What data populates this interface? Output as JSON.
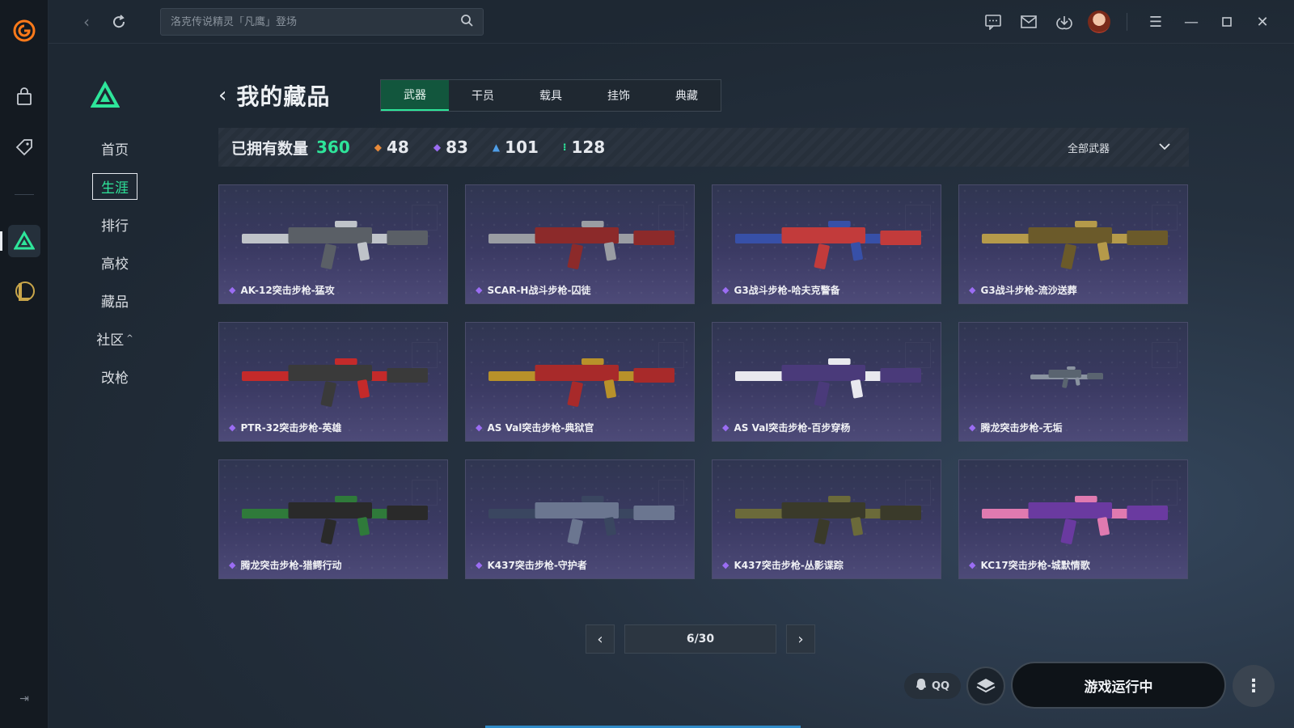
{
  "app": {
    "search_placeholder": "洛克传说精灵「凡鹰」登场"
  },
  "rail": {
    "items": [
      "app-logo",
      "store",
      "discount-tag",
      "delta-force",
      "league-of-legends"
    ]
  },
  "side_menu": {
    "items": [
      {
        "label": "首页",
        "active": false
      },
      {
        "label": "生涯",
        "active": true
      },
      {
        "label": "排行",
        "active": false
      },
      {
        "label": "高校",
        "active": false
      },
      {
        "label": "藏品",
        "active": false
      },
      {
        "label": "社区",
        "active": false,
        "chevron": "^"
      },
      {
        "label": "改枪",
        "active": false
      }
    ]
  },
  "header": {
    "title": "我的藏品",
    "tabs": [
      "武器",
      "干员",
      "载具",
      "挂饰",
      "典藏"
    ],
    "active_tab": "武器"
  },
  "stats": {
    "owned_label": "已拥有数量",
    "owned_total": "360",
    "counts": [
      {
        "value": "48",
        "color": "#e88a3a"
      },
      {
        "value": "83",
        "color": "#9b6df3"
      },
      {
        "value": "101",
        "color": "#4f9ee8"
      },
      {
        "value": "128",
        "color": "#2ee59a"
      }
    ],
    "filter_label": "全部武器"
  },
  "cards": [
    {
      "name": "AK-12突击步枪-猛攻",
      "palette": [
        "#bfc3c9",
        "#5a5f66"
      ]
    },
    {
      "name": "SCAR-H战斗步枪-囚徒",
      "palette": [
        "#9a9da3",
        "#8c2a2a"
      ]
    },
    {
      "name": "G3战斗步枪-哈夫克警备",
      "palette": [
        "#3750a8",
        "#c23b3b"
      ]
    },
    {
      "name": "G3战斗步枪-流沙送葬",
      "palette": [
        "#b59a4a",
        "#6b5a2a"
      ]
    },
    {
      "name": "PTR-32突击步枪-英雄",
      "palette": [
        "#c42a2a",
        "#3a3a3a"
      ]
    },
    {
      "name": "AS Val突击步枪-典狱官",
      "palette": [
        "#b8912a",
        "#a82a2a"
      ]
    },
    {
      "name": "AS Val突击步枪-百步穿杨",
      "palette": [
        "#e8e8ee",
        "#4a3a7a"
      ]
    },
    {
      "name": "腾龙突击步枪-无垢",
      "palette": [
        "#8a93a0",
        "#5a6470"
      ]
    },
    {
      "name": "腾龙突击步枪-猎鳄行动",
      "palette": [
        "#2f7a3a",
        "#2a2a2a"
      ]
    },
    {
      "name": "K437突击步枪-守护者",
      "palette": [
        "#3a4660",
        "#6b7690"
      ]
    },
    {
      "name": "K437突击步枪-丛影谍踪",
      "palette": [
        "#6b6a3a",
        "#3a3a2a"
      ]
    },
    {
      "name": "KC17突击步枪-城默情歌",
      "palette": [
        "#e07ab0",
        "#6a3aa0"
      ]
    }
  ],
  "pagination": {
    "current": "6/30"
  },
  "footer": {
    "qq_label": "QQ",
    "run_label": "游戏运行中"
  },
  "colors": {
    "accent": "#2ee59a",
    "rare_gem": "#9b6df3"
  }
}
